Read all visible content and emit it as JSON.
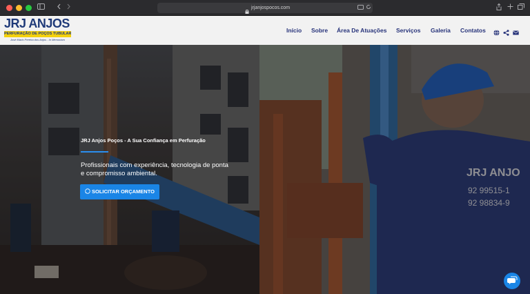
{
  "browser": {
    "url": "jrjanjospocos.com"
  },
  "logo": {
    "brand_name": "JRJ ANJOS",
    "tagline": "PERFURAÇÃO DE POÇOS TUBULARES",
    "memorial": "José Mario Pereira dos Anjos - In Memoriam"
  },
  "nav": {
    "items": [
      "Início",
      "Sobre",
      "Área De Atuações",
      "Serviços",
      "Galeria",
      "Contatos"
    ]
  },
  "hero": {
    "kicker": "JRJ Anjos Poços - A Sua Confiança em Perfuração",
    "text": "Profissionais com experiência, tecnologia de ponta e compromisso ambiental.",
    "cta_label": "SOLICITAR ORÇAMENTO"
  },
  "colors": {
    "nav_text": "#27337a",
    "accent": "#1a85e6",
    "logo_yellow": "#f4d10d"
  }
}
